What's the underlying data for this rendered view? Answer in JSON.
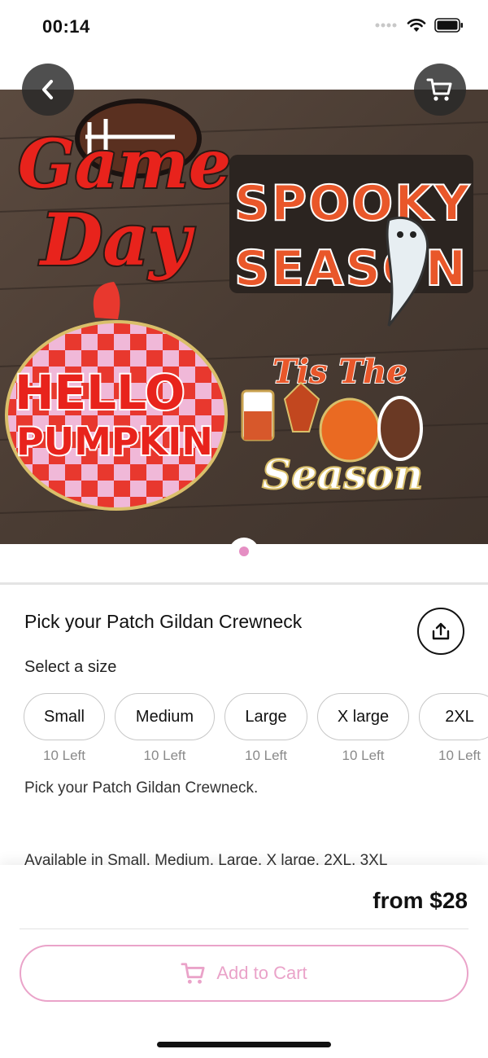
{
  "status": {
    "time": "00:14"
  },
  "hero": {
    "patches": [
      {
        "line1": "Game",
        "line2": "Day"
      },
      {
        "line1": "SPOOKY",
        "line2": "SEASON"
      },
      {
        "line1": "HELLO",
        "line2": "PUMPKIN"
      },
      {
        "line1": "Tis The",
        "line2": "Season"
      }
    ],
    "active_page": 1,
    "page_count": 1
  },
  "icons": {
    "back": "chevron-left-icon",
    "cart": "cart-icon",
    "share": "share-icon",
    "add_to_cart": "cart-icon"
  },
  "product": {
    "title": "Pick your Patch Gildan Crewneck",
    "size_label": "Select a size",
    "sizes": [
      {
        "label": "Small",
        "stock": "10 Left"
      },
      {
        "label": "Medium",
        "stock": "10 Left"
      },
      {
        "label": "Large",
        "stock": "10 Left"
      },
      {
        "label": "X large",
        "stock": "10 Left"
      },
      {
        "label": "2XL",
        "stock": "10 Left"
      }
    ],
    "description": "Pick your Patch Gildan Crewneck.",
    "availability": "Available in Small, Medium, Large, X large, 2XL, 3XL"
  },
  "checkout": {
    "price": "from $28",
    "add_to_cart": "Add to Cart"
  },
  "colors": {
    "accent_pink": "#eaa3c9",
    "pager_dot": "#e58ec3"
  }
}
